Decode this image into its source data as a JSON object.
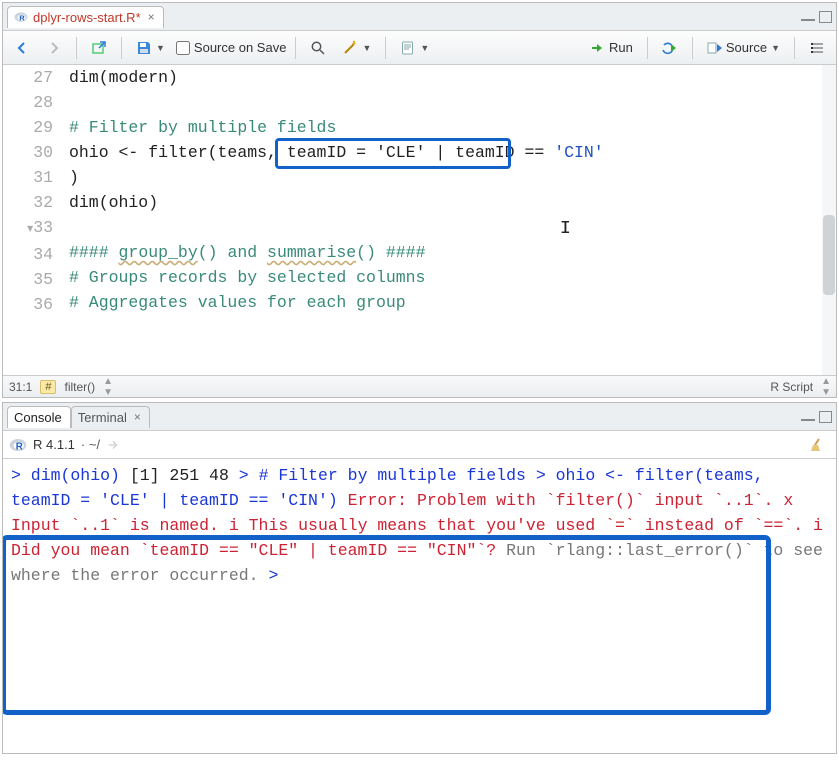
{
  "editor": {
    "tab_filename": "dplyr-rows-start.R*",
    "toolbar": {
      "source_on_save_label": "Source on Save",
      "run_label": "Run",
      "source_label": "Source"
    },
    "gutter": [
      "27",
      "28",
      "29",
      "30",
      "",
      "31",
      "32",
      "33",
      "34",
      "35",
      "36"
    ],
    "lines": {
      "l27": "dim(modern)",
      "l28": "",
      "l29": "# Filter by multiple fields",
      "l30a": "ohio <- filter(teams, ",
      "l30_boxed": "teamID = 'CLE'",
      "l30b": " | teamID == ",
      "l30c": "'CIN'",
      "l30d": ")",
      "l31": "dim(ohio)",
      "l32": "",
      "l33": "#### group_by() and summarise() ####",
      "l33_plain_a": "#### ",
      "l33_u1": "group_by",
      "l33_plain_b": "() and ",
      "l33_u2": "summarise",
      "l33_plain_c": "() ####",
      "l34": "# Groups records by selected columns",
      "l35": "# Aggregates values for each group",
      "l36": ""
    },
    "status": {
      "pos": "31:1",
      "scope_symbol": "#",
      "scope_label": "filter()",
      "language": "R Script"
    }
  },
  "console": {
    "tabs": {
      "console": "Console",
      "terminal": "Terminal"
    },
    "version": "R 4.1.1",
    "cwd": "~/",
    "lines": {
      "in1": "> dim(ohio)",
      "out1": "[1] 251  48",
      "in2": "> # Filter by multiple fields",
      "in3": "> ohio <- filter(teams, teamID = 'CLE' | teamID == 'CIN')",
      "err1": "Error: Problem with `filter()` input `..1`.",
      "err2": "x Input `..1` is named.",
      "err3": "i This usually means that you've used `=` instead of `==`.",
      "err4": "i Did you mean `teamID == \"CLE\" | teamID == \"CIN\"`?",
      "gray": "Run `rlang::last_error()` to see where the error occurred.",
      "prompt": "> "
    }
  },
  "highlight_boxes": {
    "editor_box": {
      "text": "teamID = 'CLE'"
    },
    "console_box_lines": [
      "in3",
      "err1",
      "err2",
      "err3",
      "err4",
      "gray",
      "prompt"
    ]
  }
}
